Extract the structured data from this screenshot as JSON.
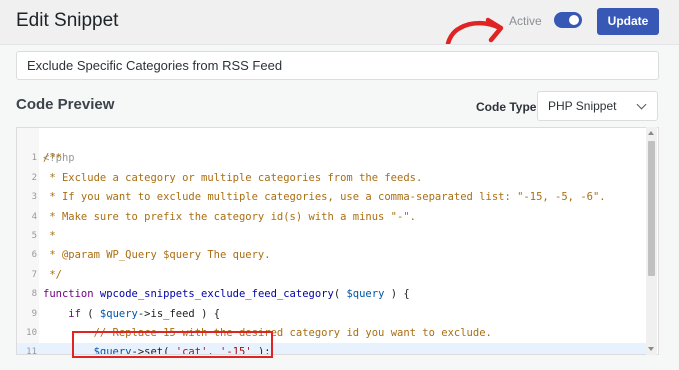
{
  "header": {
    "title": "Edit Snippet",
    "active_label": "Active",
    "toggle_state": "on",
    "update_label": "Update"
  },
  "snippet": {
    "name": "Exclude Specific Categories from RSS Feed"
  },
  "code_preview": {
    "title": "Code Preview",
    "code_type_label": "Code Type",
    "code_type_value": "PHP Snippet"
  },
  "code": {
    "open_tag": "<?php",
    "lines": [
      {
        "num": "1",
        "segments": [
          {
            "cls": "c-comment",
            "t": "/**"
          }
        ]
      },
      {
        "num": "2",
        "segments": [
          {
            "cls": "c-comment",
            "t": " * Exclude a category or multiple categories from the feeds."
          }
        ]
      },
      {
        "num": "3",
        "segments": [
          {
            "cls": "c-comment",
            "t": " * If you want to exclude multiple categories, use a comma-separated list: \"-15, -5, -6\"."
          }
        ]
      },
      {
        "num": "4",
        "segments": [
          {
            "cls": "c-comment",
            "t": " * Make sure to prefix the category id(s) with a minus \"-\"."
          }
        ]
      },
      {
        "num": "5",
        "segments": [
          {
            "cls": "c-comment",
            "t": " *"
          }
        ]
      },
      {
        "num": "6",
        "segments": [
          {
            "cls": "c-comment",
            "t": " * @param WP_Query $query The query."
          }
        ]
      },
      {
        "num": "7",
        "segments": [
          {
            "cls": "c-comment",
            "t": " */"
          }
        ]
      },
      {
        "num": "8",
        "segments": [
          {
            "cls": "c-kw",
            "t": "function "
          },
          {
            "cls": "c-fn",
            "t": "wpcode_snippets_exclude_feed_category"
          },
          {
            "cls": "c-plain",
            "t": "( "
          },
          {
            "cls": "c-var",
            "t": "$query"
          },
          {
            "cls": "c-plain",
            "t": " ) {"
          }
        ]
      },
      {
        "num": "9",
        "segments": [
          {
            "cls": "c-plain",
            "t": "    "
          },
          {
            "cls": "c-kw",
            "t": "if"
          },
          {
            "cls": "c-plain",
            "t": " ( "
          },
          {
            "cls": "c-var",
            "t": "$query"
          },
          {
            "cls": "c-plain",
            "t": "->is_feed ) {"
          }
        ]
      },
      {
        "num": "10",
        "segments": [
          {
            "cls": "c-plain",
            "t": "        "
          },
          {
            "cls": "c-comment",
            "t": "// Replace 15 with the desired category id you want to exclude."
          }
        ]
      },
      {
        "num": "11",
        "segments": [
          {
            "cls": "c-plain",
            "t": "        "
          },
          {
            "cls": "c-var",
            "t": "$query"
          },
          {
            "cls": "c-plain",
            "t": "->set( "
          },
          {
            "cls": "c-str",
            "t": "'cat'"
          },
          {
            "cls": "c-plain",
            "t": ", "
          },
          {
            "cls": "c-str",
            "t": "'-15'"
          },
          {
            "cls": "c-plain",
            "t": " );"
          }
        ],
        "highlight": true
      }
    ]
  },
  "colors": {
    "accent": "#3858b6",
    "highlight_box": "#e02424",
    "arrow": "#e02424"
  }
}
